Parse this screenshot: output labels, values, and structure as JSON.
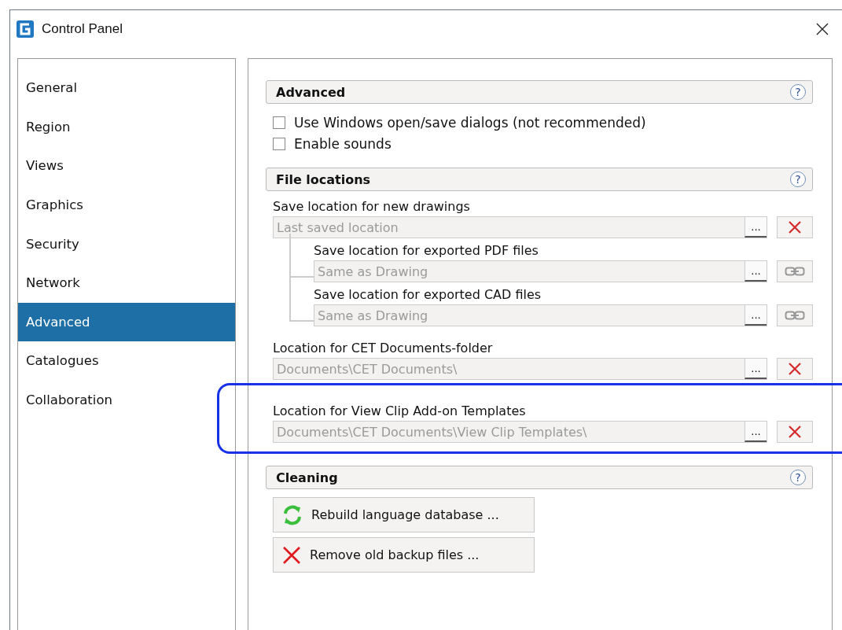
{
  "window": {
    "title": "Control Panel"
  },
  "sidebar": {
    "items": [
      {
        "label": "General",
        "selected": false
      },
      {
        "label": "Region",
        "selected": false
      },
      {
        "label": "Views",
        "selected": false
      },
      {
        "label": "Graphics",
        "selected": false
      },
      {
        "label": "Security",
        "selected": false
      },
      {
        "label": "Network",
        "selected": false
      },
      {
        "label": "Advanced",
        "selected": true
      },
      {
        "label": "Catalogues",
        "selected": false
      },
      {
        "label": "Collaboration",
        "selected": false
      }
    ]
  },
  "sections": [
    {
      "title": "Advanced",
      "help": "?",
      "kind": "options",
      "options": [
        {
          "label": "Use Windows open/save dialogs (not recommended)",
          "checked": false
        },
        {
          "label": "Enable sounds",
          "checked": false
        }
      ]
    },
    {
      "title": "File locations",
      "help": "?",
      "kind": "locations",
      "locations": [
        {
          "label": "Save location for new drawings",
          "value": "Last saved location",
          "browse": "...",
          "kind": "clear",
          "highlighted": false,
          "children": [
            {
              "label": "Save location for exported PDF files",
              "value": "Same as Drawing",
              "browse": "...",
              "kind": "link",
              "highlighted": false
            },
            {
              "label": "Save location for exported CAD files",
              "value": "Same as Drawing",
              "browse": "...",
              "kind": "link",
              "highlighted": false
            }
          ]
        },
        {
          "label": "Location for CET Documents-folder",
          "value": "Documents\\CET Documents\\",
          "browse": "...",
          "kind": "clear",
          "highlighted": false
        },
        {
          "label": "Location for View Clip Add-on Templates",
          "value": "Documents\\CET Documents\\View Clip Templates\\",
          "browse": "...",
          "kind": "clear",
          "highlighted": true
        }
      ]
    },
    {
      "title": "Cleaning",
      "help": "?",
      "kind": "actions",
      "actions": [
        {
          "label": "Rebuild language database ...",
          "kind": "refresh"
        },
        {
          "label": "Remove old backup files ...",
          "kind": "remove"
        }
      ]
    }
  ]
}
